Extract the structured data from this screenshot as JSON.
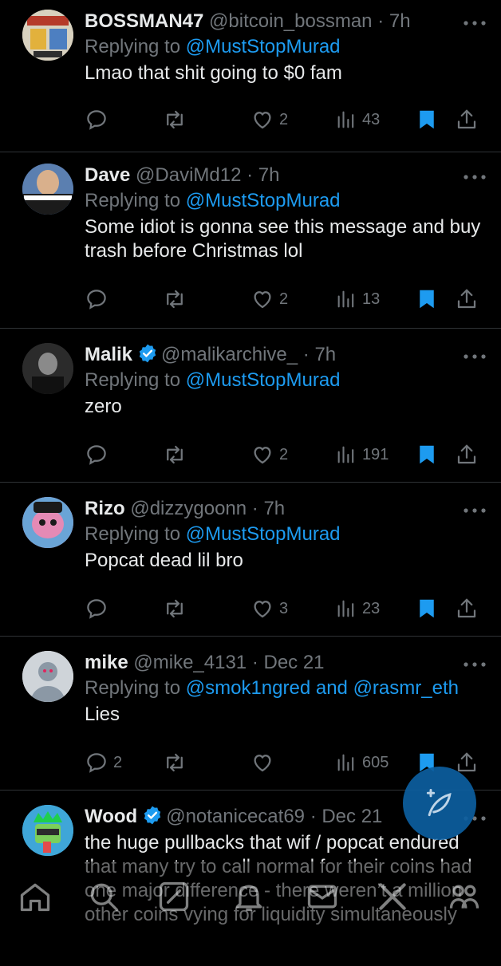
{
  "tweets": [
    {
      "name": "BOSSMAN47",
      "handle": "@bitcoin_bossman",
      "time": "· 7h",
      "verified": false,
      "replying_prefix": "Replying to ",
      "replying_to": "@MustStopMurad",
      "text": "Lmao that shit going to $0 fam",
      "replies": "",
      "retweets": "",
      "likes": "2",
      "views": "43",
      "avatar_color": "#c9c4b8"
    },
    {
      "name": "Dave",
      "handle": "@DaviMd12",
      "time": "· 7h",
      "verified": false,
      "replying_prefix": "Replying to ",
      "replying_to": "@MustStopMurad",
      "text": "Some idiot is gonna see this message and buy trash before Christmas lol",
      "replies": "",
      "retweets": "",
      "likes": "2",
      "views": "13",
      "avatar_color": "#3a5a8a"
    },
    {
      "name": "Malik",
      "handle": "@malikarchive_",
      "time": "· 7h",
      "verified": true,
      "replying_prefix": "Replying to ",
      "replying_to": "@MustStopMurad",
      "text": "zero",
      "replies": "",
      "retweets": "",
      "likes": "2",
      "views": "191",
      "avatar_color": "#2a2a2a"
    },
    {
      "name": "Rizo",
      "handle": "@dizzygoonn",
      "time": "· 7h",
      "verified": false,
      "replying_prefix": "Replying to ",
      "replying_to": "@MustStopMurad",
      "text": "Popcat dead lil bro",
      "replies": "",
      "retweets": "",
      "likes": "3",
      "views": "23",
      "avatar_color": "#d97aa8"
    },
    {
      "name": "mike",
      "handle": "@mike_4131",
      "time": "· Dec 21",
      "verified": false,
      "replying_prefix": "Replying to ",
      "replying_to": "@smok1ngred and @rasmr_eth",
      "text": "Lies",
      "replies": "2",
      "retweets": "",
      "likes": "",
      "views": "605",
      "avatar_color": "#c8cdd2"
    },
    {
      "name": "Wood",
      "handle": "@notanicecat69",
      "time": "· Dec 21",
      "verified": true,
      "replying_prefix": "",
      "replying_to": "",
      "text": "the huge pullbacks that wif / popcat endured that many try to call normal for their coins had one major difference - there weren’t a million other coins vying for liquidity simultaneously",
      "replies": "",
      "retweets": "",
      "likes": "",
      "views": "",
      "avatar_color": "#3fa6d8"
    }
  ],
  "colors": {
    "accent": "#1d9bf0",
    "muted": "#71767b",
    "text": "#e7e9ea",
    "divider": "#2f3336",
    "fab": "#0c5fa0"
  },
  "nav_icons": [
    "home-icon",
    "search-icon",
    "grok-icon",
    "notifications-icon",
    "messages-icon",
    "x-logo-icon",
    "communities-icon"
  ]
}
